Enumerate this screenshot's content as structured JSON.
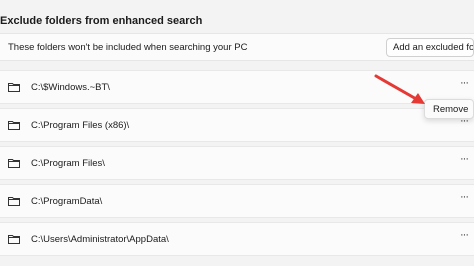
{
  "section": {
    "title": "Exclude folders from enhanced search"
  },
  "info": {
    "text": "These folders won't be included when searching your PC",
    "add_button_label": "Add an excluded folder"
  },
  "folders": [
    {
      "path": "C:\\$Windows.~BT\\"
    },
    {
      "path": "C:\\Program Files (x86)\\"
    },
    {
      "path": "C:\\Program Files\\"
    },
    {
      "path": "C:\\ProgramData\\"
    },
    {
      "path": "C:\\Users\\Administrator\\AppData\\"
    }
  ],
  "context_menu": {
    "remove_label": "Remove"
  },
  "icons": {
    "folder": "folder-icon",
    "more": "more-options-icon",
    "annotation": "red-arrow"
  },
  "colors": {
    "annotation_arrow": "#e53935",
    "background": "#f3f3f3",
    "card": "#fbfbfb"
  }
}
